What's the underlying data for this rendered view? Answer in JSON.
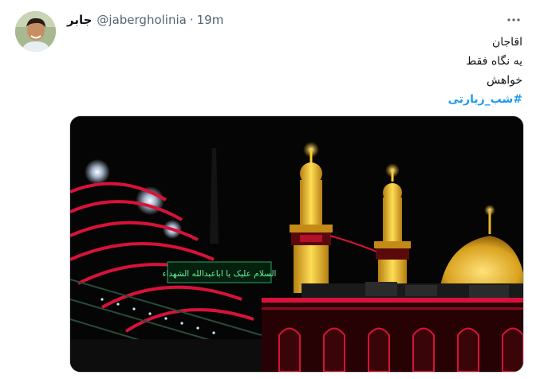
{
  "author": {
    "name": "جابر",
    "handle": "@jabergholinia",
    "separator": "·",
    "time": "19m"
  },
  "menu_icon": "more-horizontal-icon",
  "tweet": {
    "lines": [
      "اقاجان",
      "یه نگاه فقط",
      "خواهش"
    ],
    "hashtag": "#شب_زیارتی"
  },
  "media": {
    "sign_text": "السلام علیک یا اباعبدالله الشهداء"
  },
  "colors": {
    "link": "#1d9bf0",
    "muted": "#536471",
    "text": "#0f1419",
    "gold": "#e9c23a",
    "red_light": "#d8123a"
  }
}
